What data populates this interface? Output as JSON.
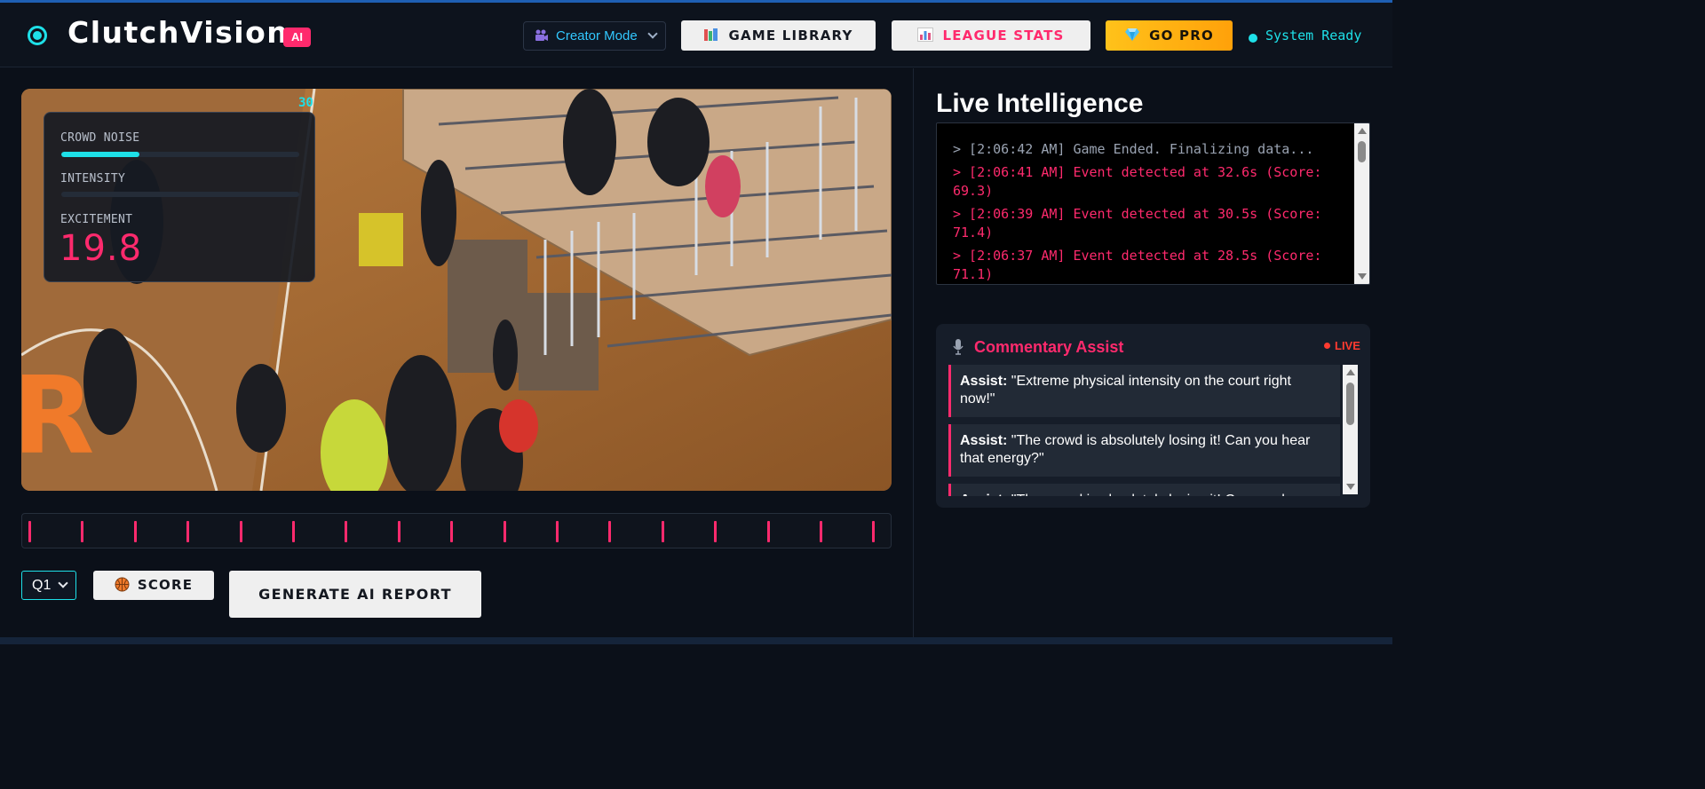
{
  "header": {
    "brand": "ClutchVision",
    "ai_badge": "AI",
    "mode_select": "Creator Mode",
    "game_library": "GAME LIBRARY",
    "league_stats": "LEAGUE STATS",
    "go_pro": "GO PRO",
    "status": "System Ready"
  },
  "video": {
    "frame_counter": "30",
    "metrics": {
      "crowd_noise_label": "CROWD NOISE",
      "crowd_noise_level": 0.33,
      "intensity_label": "INTENSITY",
      "intensity_level": 0.0,
      "excitement_label": "EXCITEMENT",
      "excitement_value": "19.8"
    }
  },
  "timeline": {
    "event_count": 17
  },
  "controls": {
    "quarter": "Q1",
    "score_label": "SCORE",
    "report_label": "GENERATE AI REPORT"
  },
  "live_intelligence": {
    "title": "Live Intelligence",
    "log": [
      {
        "text": "> [2:06:42 AM] Game Ended. Finalizing data...",
        "level": "info"
      },
      {
        "text": "> [2:06:41 AM] Event detected at 32.6s (Score: 69.3)",
        "level": "event"
      },
      {
        "text": "> [2:06:39 AM] Event detected at 30.5s (Score: 71.4)",
        "level": "event"
      },
      {
        "text": "> [2:06:37 AM] Event detected at 28.5s (Score: 71.1)",
        "level": "event"
      }
    ]
  },
  "commentary": {
    "title": "Commentary Assist",
    "live_label": "LIVE",
    "items": [
      {
        "speaker": "Assist:",
        "text": "\"Extreme physical intensity on the court right now!\""
      },
      {
        "speaker": "Assist:",
        "text": "\"The crowd is absolutely losing it! Can you hear that energy?\""
      },
      {
        "speaker": "Assist:",
        "text": "\"The crowd is absolutely losing it! Can you hear that energy?\""
      }
    ]
  },
  "colors": {
    "accent_cyan": "#1ee0e8",
    "accent_pink": "#ff2a6d",
    "pro_gold": "#ffb300",
    "background": "#0b1019"
  },
  "icons": {
    "logo": "target-dot-icon",
    "mode": "video-camera-icon",
    "library": "books-icon",
    "stats": "bar-chart-icon",
    "pro": "diamond-icon",
    "score": "basketball-icon",
    "commentary": "microphone-icon"
  }
}
